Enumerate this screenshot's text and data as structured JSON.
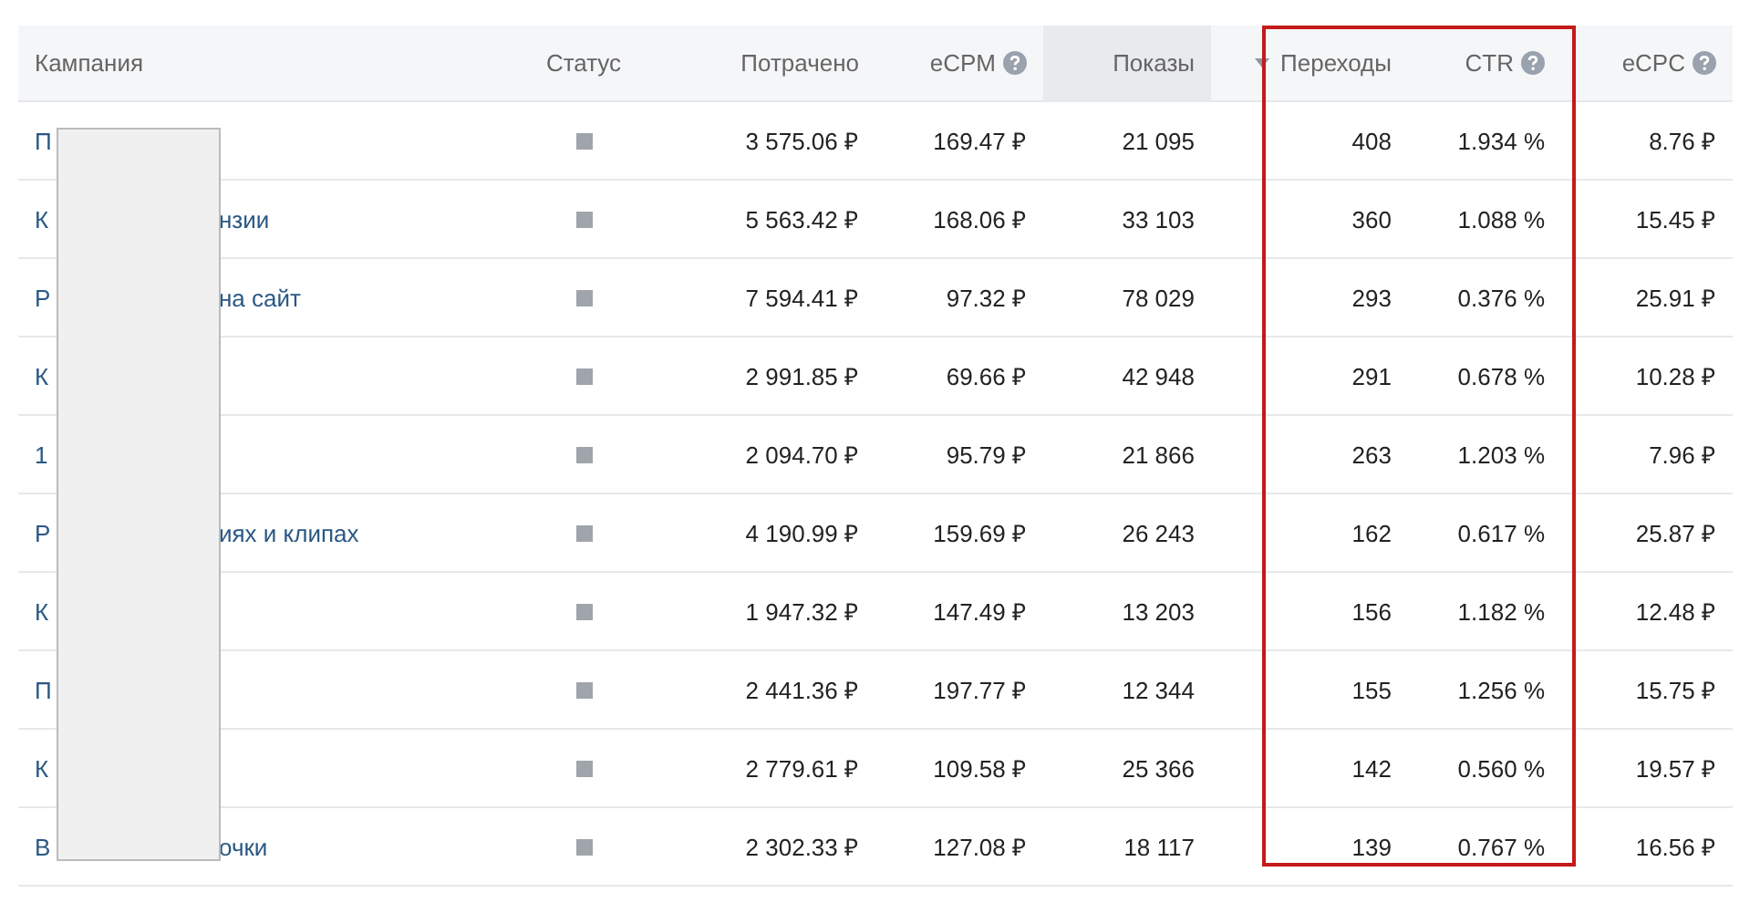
{
  "columns": [
    {
      "label": "Кампания",
      "help": false,
      "highlighted": false,
      "sort_caret": false
    },
    {
      "label": "Статус",
      "help": false,
      "highlighted": false,
      "sort_caret": false
    },
    {
      "label": "Потрачено",
      "help": false,
      "highlighted": false,
      "sort_caret": false
    },
    {
      "label": "eCPM",
      "help": true,
      "highlighted": false,
      "sort_caret": false
    },
    {
      "label": "Показы",
      "help": false,
      "highlighted": true,
      "sort_caret": false
    },
    {
      "label": "Переходы",
      "help": false,
      "highlighted": false,
      "sort_caret": true
    },
    {
      "label": "CTR",
      "help": true,
      "highlighted": false,
      "sort_caret": false
    },
    {
      "label": "eCPC",
      "help": true,
      "highlighted": false,
      "sort_caret": false
    }
  ],
  "rows": [
    {
      "name_start": "П",
      "active": false,
      "spent": "3 575.06 ₽",
      "ecpm": "169.47 ₽",
      "impressions": "21 095",
      "clicks": "408",
      "ctr": "1.934 %",
      "ecpc": "8.76 ₽"
    },
    {
      "name_start": "К",
      "name_end": "нзии",
      "active": false,
      "spent": "5 563.42 ₽",
      "ecpm": "168.06 ₽",
      "impressions": "33 103",
      "clicks": "360",
      "ctr": "1.088 %",
      "ecpc": "15.45 ₽"
    },
    {
      "name_start": "Р",
      "name_end": "на сайт",
      "active": false,
      "spent": "7 594.41 ₽",
      "ecpm": "97.32 ₽",
      "impressions": "78 029",
      "clicks": "293",
      "ctr": "0.376 %",
      "ecpc": "25.91 ₽"
    },
    {
      "name_start": "К",
      "active": false,
      "spent": "2 991.85 ₽",
      "ecpm": "69.66 ₽",
      "impressions": "42 948",
      "clicks": "291",
      "ctr": "0.678 %",
      "ecpc": "10.28 ₽"
    },
    {
      "name_start": "1",
      "active": false,
      "spent": "2 094.70 ₽",
      "ecpm": "95.79 ₽",
      "impressions": "21 866",
      "clicks": "263",
      "ctr": "1.203 %",
      "ecpc": "7.96 ₽"
    },
    {
      "name_start": "Р",
      "name_end": "иях и клипах",
      "active": false,
      "spent": "4 190.99 ₽",
      "ecpm": "159.69 ₽",
      "impressions": "26 243",
      "clicks": "162",
      "ctr": "0.617 %",
      "ecpc": "25.87 ₽"
    },
    {
      "name_start": "К",
      "active": false,
      "spent": "1 947.32 ₽",
      "ecpm": "147.49 ₽",
      "impressions": "13 203",
      "clicks": "156",
      "ctr": "1.182 %",
      "ecpc": "12.48 ₽"
    },
    {
      "name_start": "П",
      "active": false,
      "spent": "2 441.36 ₽",
      "ecpm": "197.77 ₽",
      "impressions": "12 344",
      "clicks": "155",
      "ctr": "1.256 %",
      "ecpc": "15.75 ₽"
    },
    {
      "name_start": "К",
      "active": false,
      "spent": "2 779.61 ₽",
      "ecpm": "109.58 ₽",
      "impressions": "25 366",
      "clicks": "142",
      "ctr": "0.560 %",
      "ecpc": "19.57 ₽"
    },
    {
      "name_start": "В",
      "name_end": "очки",
      "active": false,
      "spent": "2 302.33 ₽",
      "ecpm": "127.08 ₽",
      "impressions": "18 117",
      "clicks": "139",
      "ctr": "0.767 %",
      "ecpc": "16.56 ₽"
    }
  ]
}
